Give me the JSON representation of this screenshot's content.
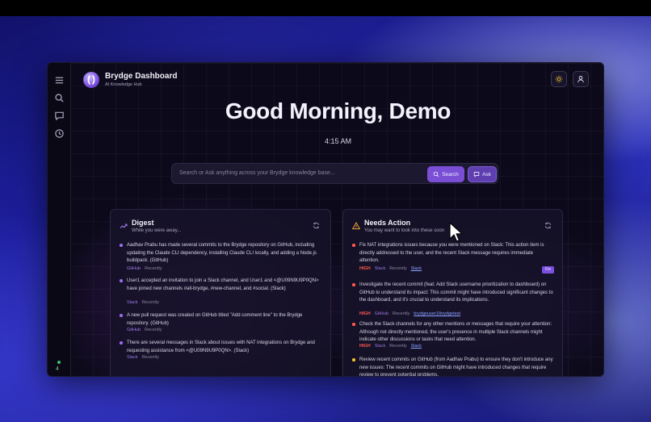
{
  "app": {
    "title": "Brydge Dashboard",
    "subtitle": "AI Knowledge Hub"
  },
  "sidebar": {
    "icons": [
      "menu-icon",
      "search-icon",
      "chat-icon",
      "clock-icon"
    ],
    "status_count": "4"
  },
  "header": {
    "greeting": "Good Morning, Demo",
    "time": "4:15 AM"
  },
  "search": {
    "placeholder": "Search or Ask anything across your Brydge knowledge base...",
    "search_label": "Search",
    "ask_label": "Ask"
  },
  "digest": {
    "title": "Digest",
    "subtitle": "While you were away...",
    "items": [
      {
        "text": "Aadhav Prabu has made several commits to the Brydge repository on GitHub, including updating the Claude CLI dependency, installing Claude CLI locally, and adding a Node.js buildpack. (GitHub)",
        "source": "GitHub",
        "time": "Recently"
      },
      {
        "text": "User1 accepted an invitation to join a Slack channel, and User1 and <@U09N9U9P0QN> have joined new channels #all-brydge, #new-channel, and #social. (Slack)",
        "source": "Slack",
        "time": "Recently"
      },
      {
        "text": "A new pull request was created on GitHub titled \"Add comment line\" to the Brydge repository. (GitHub)",
        "source": "GitHub",
        "time": "Recently"
      },
      {
        "text": "There are several messages in Slack about issues with NAT integrations on Brydge and requesting assistance from <@U09N9U9P0QN>. (Slack)",
        "source": "Slack",
        "time": "Recently"
      }
    ]
  },
  "needs_action": {
    "title": "Needs Action",
    "subtitle": "You may want to look into these soon",
    "fix_label": "Fix",
    "items": [
      {
        "text": "Fix NAT integrations issues because you were mentioned on Slack: This action item is directly addressed to the user, and the recent Slack message requires immediate attention.",
        "priority": "HIGH",
        "source": "Slack",
        "time": "Recently",
        "link": "Slack"
      },
      {
        "text": "Investigate the recent commit (feat: Add Slack username prioritization to dashboard) on GitHub to understand its impact: This commit might have introduced significant changes to the dashboard, and it's crucial to understand its implications.",
        "priority": "HIGH",
        "source": "GitHub",
        "time": "Recently",
        "link": "brydgeuser1/brydgetest"
      },
      {
        "text": "Check the Slack channels for any other mentions or messages that require your attention: Although not directly mentioned, the user's presence in multiple Slack channels might indicate other discussions or tasks that need attention.",
        "priority": "HIGH",
        "source": "Slack",
        "time": "Recently",
        "link": "Slack"
      },
      {
        "text": "Review recent commits on GitHub (from Aadhav Prabu) to ensure they don't introduce any new issues: The recent commits on GitHub might have introduced changes that require review to prevent potential problems."
      }
    ]
  },
  "colors": {
    "accent": "#7a4fd6",
    "bullet_purple": "#9b6cf0",
    "bullet_red": "#ff5a4f",
    "bullet_yellow": "#f2c230",
    "high": "#ff5a4f"
  }
}
